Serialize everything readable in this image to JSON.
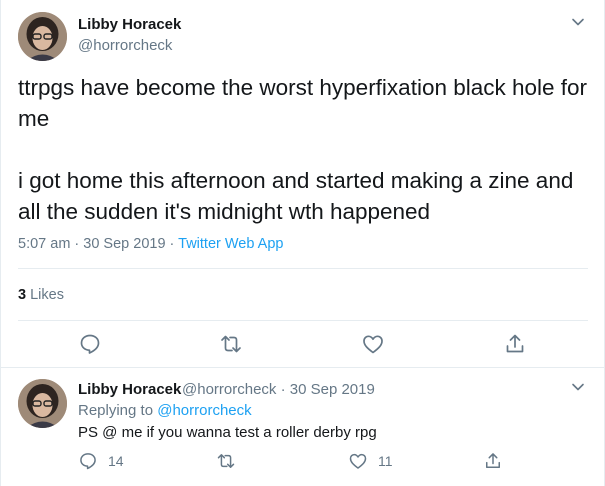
{
  "tweet": {
    "author_name": "Libby Horacek",
    "author_handle": "@horrorcheck",
    "text": "ttrpgs have become the worst hyperfixation black hole for me\n\ni got home this afternoon and started making a zine and all the sudden it's midnight wth happened",
    "time": "5:07 am · 30 Sep 2019 · ",
    "source": "Twitter Web App",
    "like_count": "3",
    "like_label": " Likes",
    "icons": [
      "chevron-down-icon",
      "reply-icon",
      "retweet-icon",
      "like-icon",
      "share-icon"
    ]
  },
  "reply": {
    "author_name": "Libby Horacek",
    "author_handle_date": "@horrorcheck · 30 Sep 2019",
    "replying_label": "Replying to ",
    "replying_handle": "@horrorcheck",
    "text": "PS @ me if you wanna test a roller derby rpg",
    "reply_count": "14",
    "like_count": "11"
  },
  "colors": {
    "accent": "#1da1f2",
    "secondary_text": "#657786",
    "primary_text": "#14171a",
    "divider": "#e6ecf0"
  }
}
